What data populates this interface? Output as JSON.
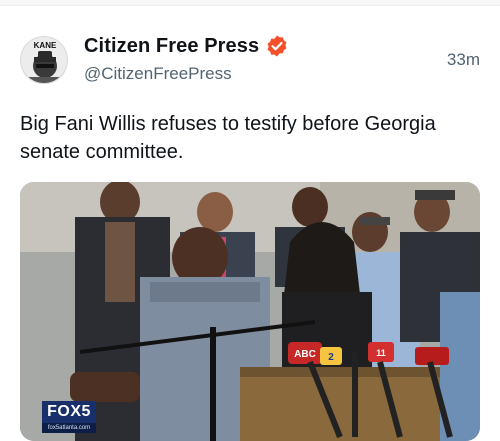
{
  "post": {
    "display_name": "Citizen Free Press",
    "handle": "@CitizenFreePress",
    "timestamp": "33m",
    "text": "Big Fani Willis refuses to testify before Georgia senate committee.",
    "avatar_label": "KANE"
  },
  "media": {
    "station_logo": "FOX5",
    "station_site": "fox5atlanta.com",
    "mic_tag": "ABC",
    "mic_tag_2": "2",
    "mic_tag_3": "11",
    "icons": [
      "verified-badge-icon"
    ]
  },
  "colors": {
    "verified": "#f5502c",
    "text_primary": "#0f1419",
    "text_secondary": "#536471",
    "fox_blue": "#17306b"
  }
}
